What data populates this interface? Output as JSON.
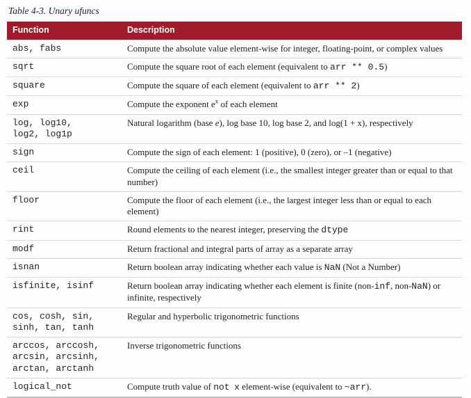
{
  "caption": "Table 4-3. Unary ufuncs",
  "headers": {
    "fn": "Function",
    "dsc": "Description"
  },
  "rows": [
    {
      "fn": "abs, fabs",
      "dsc": "Compute the absolute value element-wise for integer, floating-point, or complex values"
    },
    {
      "fn": "sqrt",
      "dsc": "Compute the square root of each element (equivalent to <span class=\"mono\">arr ** 0.5</span>)"
    },
    {
      "fn": "square",
      "dsc": "Compute the square of each element (equivalent to <span class=\"mono\">arr ** 2</span>)"
    },
    {
      "fn": "exp",
      "dsc": "Compute the exponent e<sup>x</sup> of each element"
    },
    {
      "fn": "log, log10,\nlog2, log1p",
      "dsc": "Natural logarithm (base <span class=\"ital\">e</span>), log base 10, log base 2, and log(1 + x), respectively"
    },
    {
      "fn": "sign",
      "dsc": "Compute the sign of each element: 1 (positive), 0 (zero), or –1 (negative)"
    },
    {
      "fn": "ceil",
      "dsc": "Compute the ceiling of each element (i.e., the smallest integer greater than or equal to that number)"
    },
    {
      "fn": "floor",
      "dsc": "Compute the floor of each element (i.e., the largest integer less than or equal to each element)"
    },
    {
      "fn": "rint",
      "dsc": "Round elements to the nearest integer, preserving the <span class=\"mono\">dtype</span>"
    },
    {
      "fn": "modf",
      "dsc": "Return fractional and integral parts of array as a separate array"
    },
    {
      "fn": "isnan",
      "dsc": "Return boolean array indicating whether each value is <span class=\"mono\">NaN</span> (Not a Number)"
    },
    {
      "fn": "isfinite, isinf",
      "dsc": "Return boolean array indicating whether each element is finite (non-<span class=\"mono\">inf</span>, non-<span class=\"mono\">NaN</span>) or infinite, respectively"
    },
    {
      "fn": "cos, cosh, sin,\nsinh, tan, tanh",
      "dsc": "Regular and hyperbolic trigonometric functions"
    },
    {
      "fn": "arccos, arccosh,\narcsin, arcsinh,\narctan, arctanh",
      "dsc": "Inverse trigonometric functions"
    },
    {
      "fn": "logical_not",
      "dsc": "Compute truth value of <span class=\"mono\">not</span>&nbsp; <span class=\"mono\">x</span> element-wise (equivalent to <span class=\"mono\">~arr</span>)."
    }
  ]
}
